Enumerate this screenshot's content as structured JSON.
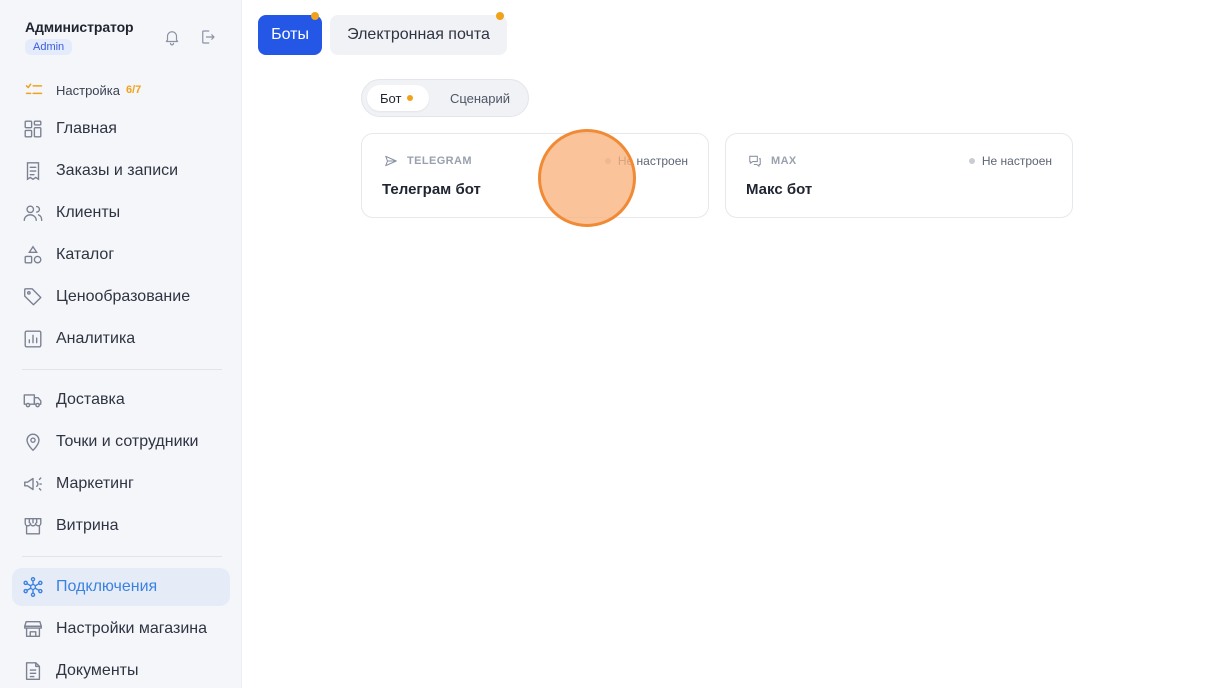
{
  "sidebar": {
    "user": {
      "name": "Администратор",
      "role": "Admin"
    },
    "header_icons": [
      "bell-icon",
      "logout-icon"
    ],
    "setup": {
      "label": "Настройка",
      "count": "6/7",
      "icon": "checklist-icon"
    },
    "nav_group_1": [
      {
        "label": "Главная",
        "icon": "dashboard-icon"
      },
      {
        "label": "Заказы и записи",
        "icon": "orders-icon"
      },
      {
        "label": "Клиенты",
        "icon": "users-icon"
      },
      {
        "label": "Каталог",
        "icon": "catalog-icon"
      },
      {
        "label": "Ценообразование",
        "icon": "tag-icon"
      },
      {
        "label": "Аналитика",
        "icon": "analytics-icon"
      }
    ],
    "nav_group_2": [
      {
        "label": "Доставка",
        "icon": "truck-icon"
      },
      {
        "label": "Точки и сотрудники",
        "icon": "location-pin-icon"
      },
      {
        "label": "Маркетинг",
        "icon": "megaphone-icon"
      },
      {
        "label": "Витрина",
        "icon": "storefront-icon"
      }
    ],
    "nav_group_3": [
      {
        "label": "Подключения",
        "icon": "connections-icon",
        "active": true
      },
      {
        "label": "Настройки магазина",
        "icon": "store-settings-icon"
      },
      {
        "label": "Документы",
        "icon": "document-icon"
      }
    ]
  },
  "top_tabs": [
    {
      "label": "Боты",
      "active": true,
      "has_dot": true
    },
    {
      "label": "Электронная почта",
      "active": false,
      "has_dot": true
    }
  ],
  "segments": [
    {
      "label": "Бот",
      "active": true,
      "has_dot": true
    },
    {
      "label": "Сценарий",
      "active": false
    }
  ],
  "cards": [
    {
      "platform": "TELEGRAM",
      "icon": "send-icon",
      "status": "Не настроен",
      "title": "Телеграм бот"
    },
    {
      "platform": "MAX",
      "icon": "chat-icon",
      "status": "Не настроен",
      "title": "Макс бот"
    }
  ],
  "colors": {
    "primary": "#2457e6",
    "accent_orange": "#f0a21a",
    "active_nav": "#3b82e0",
    "sidebar_bg": "#f5f6f9"
  }
}
